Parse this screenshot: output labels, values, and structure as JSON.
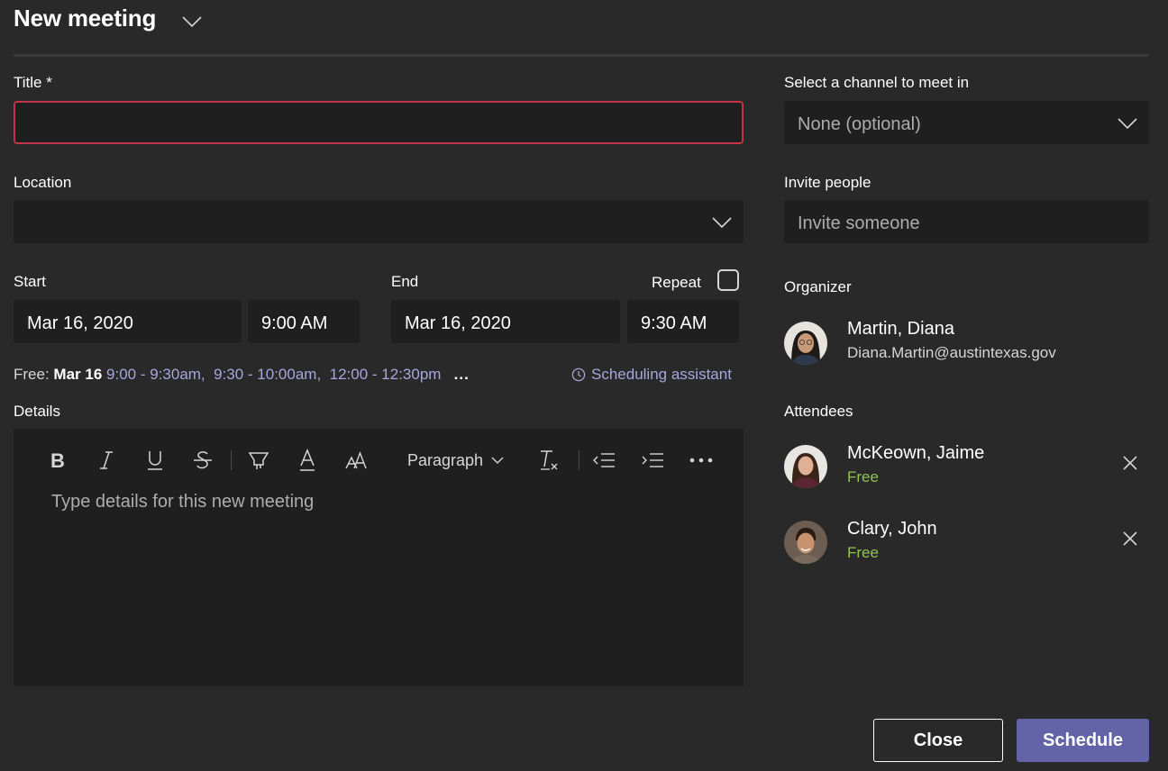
{
  "header": {
    "title": "New meeting"
  },
  "form": {
    "title_label": "Title *",
    "title_value": "",
    "location_label": "Location",
    "location_value": "",
    "start_label": "Start",
    "start_date": "Mar 16, 2020",
    "start_time": "9:00 AM",
    "end_label": "End",
    "end_date": "Mar 16, 2020",
    "end_time": "9:30 AM",
    "repeat_label": "Repeat",
    "repeat_checked": false,
    "free_prefix": "Free:",
    "free_date": "Mar 16",
    "free_slots": [
      "9:00 - 9:30am,",
      "9:30 - 10:00am,",
      "12:00 - 12:30pm"
    ],
    "free_more": "...",
    "scheduling_assistant": "Scheduling assistant",
    "details_label": "Details",
    "details_placeholder": "Type details for this new meeting"
  },
  "toolbar": {
    "paragraph_label": "Paragraph",
    "icons": [
      "bold-icon",
      "italic-icon",
      "underline-icon",
      "strikethrough-icon",
      "highlight-icon",
      "font-color-icon",
      "font-size-icon",
      "paragraph-dropdown",
      "clear-formatting-icon",
      "decrease-indent-icon",
      "increase-indent-icon",
      "more-options-icon"
    ]
  },
  "sidebar": {
    "channel_label": "Select a channel to meet in",
    "channel_value": "None (optional)",
    "invite_label": "Invite people",
    "invite_placeholder": "Invite someone",
    "organizer_label": "Organizer",
    "organizer": {
      "name": "Martin, Diana",
      "email": "Diana.Martin@austintexas.gov"
    },
    "attendees_label": "Attendees",
    "attendees": [
      {
        "name": "McKeown, Jaime",
        "status": "Free"
      },
      {
        "name": "Clary, John",
        "status": "Free"
      }
    ]
  },
  "footer": {
    "close_label": "Close",
    "schedule_label": "Schedule"
  },
  "colors": {
    "background": "#292929",
    "field": "#1f1f1f",
    "accent": "#6264a7",
    "link": "#a6a7dc",
    "error_border": "#c4314b",
    "free_status": "#92c353"
  }
}
